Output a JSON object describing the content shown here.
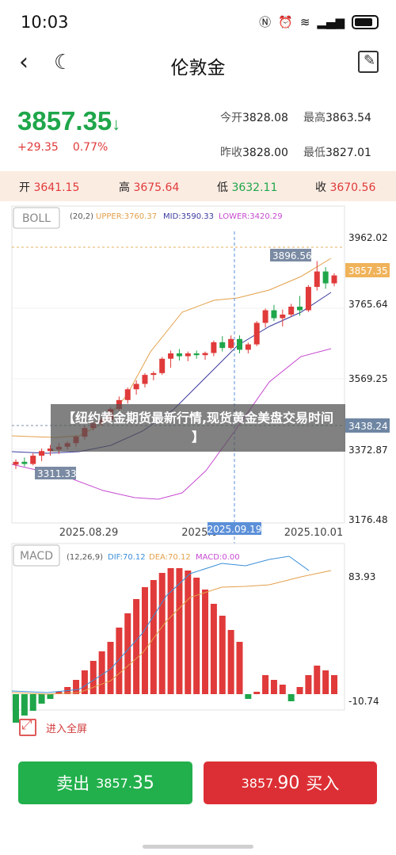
{
  "status": {
    "time": "10:03",
    "icons": [
      "nfc-icon",
      "alarm-icon",
      "wifi-icon",
      "signal-icon",
      "battery-icon"
    ]
  },
  "nav": {
    "title": "伦敦金"
  },
  "quote": {
    "price": "3857.35",
    "arrow": "↓",
    "change": "+29.35",
    "change_pct": "0.77%",
    "open_label": "今开",
    "open": "3828.08",
    "high_label": "最高",
    "high": "3863.54",
    "prev_close_label": "昨收",
    "prev_close": "3828.00",
    "low_label": "最低",
    "low": "3827.01"
  },
  "ohlc": {
    "open_label": "开",
    "open": "3641.15",
    "high_label": "高",
    "high": "3675.64",
    "low_label": "低",
    "low": "3632.11",
    "close_label": "收",
    "close": "3670.56"
  },
  "boll": {
    "tag": "BOLL",
    "params": "(20,2)",
    "upper": "UPPER:3760.37",
    "mid": "MID:3590.33",
    "lower": "LOWER:3420.29"
  },
  "price_axis": [
    "3962.02",
    "3765.64",
    "3569.25",
    "3372.87",
    "3176.48"
  ],
  "date_axis": [
    "2025.08.29",
    "2025.0",
    "2025.10.01"
  ],
  "crosshair": {
    "date": "2025.09.19",
    "price": "3438.24",
    "last_price": "3857.35",
    "high_mark": "3896.56",
    "low_mark": "3311.33"
  },
  "overlay_banner": "【纽约黄金期货最新行情,现货黄金美盘交易时间】",
  "macd": {
    "tag": "MACD",
    "params": "(12,26,9)",
    "dif": "DIF:70.12",
    "dea": "DEA:70.12",
    "macd": "MACD:0.00",
    "axis_top": "83.93",
    "axis_bottom": "-10.74"
  },
  "fullscreen_label": "进入全屏",
  "buttons": {
    "sell_label": "卖出",
    "sell_price_small": "3857.",
    "sell_price_big": "35",
    "buy_label": "买入",
    "buy_price_small": "3857.",
    "buy_price_big": "90"
  },
  "colors": {
    "up": "#e03a3a",
    "down": "#1fa64a",
    "upper": "#e3a04a",
    "mid": "#3b3ba0",
    "lower": "#c64ad0",
    "dif": "#3b8fd8",
    "dea": "#e3a04a"
  },
  "chart_data": {
    "type": "candlestick",
    "ylim": [
      3176.48,
      3962.02
    ],
    "candles": [
      {
        "o": 3330,
        "h": 3345,
        "l": 3318,
        "c": 3338
      },
      {
        "o": 3338,
        "h": 3350,
        "l": 3325,
        "c": 3332
      },
      {
        "o": 3332,
        "h": 3362,
        "l": 3328,
        "c": 3355
      },
      {
        "o": 3355,
        "h": 3375,
        "l": 3340,
        "c": 3368
      },
      {
        "o": 3368,
        "h": 3385,
        "l": 3355,
        "c": 3375
      },
      {
        "o": 3372,
        "h": 3390,
        "l": 3360,
        "c": 3380
      },
      {
        "o": 3380,
        "h": 3395,
        "l": 3372,
        "c": 3390
      },
      {
        "o": 3390,
        "h": 3412,
        "l": 3380,
        "c": 3408
      },
      {
        "o": 3408,
        "h": 3438,
        "l": 3400,
        "c": 3432
      },
      {
        "o": 3432,
        "h": 3452,
        "l": 3425,
        "c": 3445
      },
      {
        "o": 3445,
        "h": 3462,
        "l": 3438,
        "c": 3455
      },
      {
        "o": 3455,
        "h": 3490,
        "l": 3450,
        "c": 3485
      },
      {
        "o": 3485,
        "h": 3520,
        "l": 3480,
        "c": 3510
      },
      {
        "o": 3510,
        "h": 3545,
        "l": 3500,
        "c": 3540
      },
      {
        "o": 3540,
        "h": 3565,
        "l": 3525,
        "c": 3555
      },
      {
        "o": 3555,
        "h": 3585,
        "l": 3545,
        "c": 3580
      },
      {
        "o": 3580,
        "h": 3590,
        "l": 3565,
        "c": 3585
      },
      {
        "o": 3585,
        "h": 3630,
        "l": 3580,
        "c": 3625
      },
      {
        "o": 3625,
        "h": 3648,
        "l": 3600,
        "c": 3640
      },
      {
        "o": 3640,
        "h": 3652,
        "l": 3620,
        "c": 3632
      },
      {
        "o": 3632,
        "h": 3645,
        "l": 3618,
        "c": 3640
      },
      {
        "o": 3640,
        "h": 3648,
        "l": 3625,
        "c": 3635
      },
      {
        "o": 3635,
        "h": 3645,
        "l": 3622,
        "c": 3641
      },
      {
        "o": 3641,
        "h": 3676,
        "l": 3632,
        "c": 3671
      },
      {
        "o": 3671,
        "h": 3688,
        "l": 3645,
        "c": 3655
      },
      {
        "o": 3655,
        "h": 3690,
        "l": 3650,
        "c": 3680
      },
      {
        "o": 3680,
        "h": 3690,
        "l": 3640,
        "c": 3650
      },
      {
        "o": 3650,
        "h": 3670,
        "l": 3640,
        "c": 3665
      },
      {
        "o": 3665,
        "h": 3730,
        "l": 3660,
        "c": 3725
      },
      {
        "o": 3725,
        "h": 3765,
        "l": 3712,
        "c": 3760
      },
      {
        "o": 3760,
        "h": 3775,
        "l": 3730,
        "c": 3738
      },
      {
        "o": 3738,
        "h": 3762,
        "l": 3715,
        "c": 3748
      },
      {
        "o": 3748,
        "h": 3778,
        "l": 3742,
        "c": 3770
      },
      {
        "o": 3770,
        "h": 3800,
        "l": 3745,
        "c": 3760
      },
      {
        "o": 3760,
        "h": 3830,
        "l": 3755,
        "c": 3825
      },
      {
        "o": 3825,
        "h": 3897,
        "l": 3815,
        "c": 3868
      },
      {
        "o": 3868,
        "h": 3880,
        "l": 3820,
        "c": 3835
      },
      {
        "o": 3835,
        "h": 3863,
        "l": 3827,
        "c": 3857
      }
    ],
    "macd_hist": [
      -12,
      -9,
      -7,
      -4,
      -2,
      1,
      3,
      6,
      10,
      14,
      18,
      22,
      28,
      34,
      40,
      45,
      48,
      51,
      53,
      53,
      52,
      49,
      44,
      38,
      33,
      27,
      22,
      -2,
      1,
      8,
      6,
      4,
      -3,
      3,
      8,
      12,
      10,
      8
    ]
  }
}
